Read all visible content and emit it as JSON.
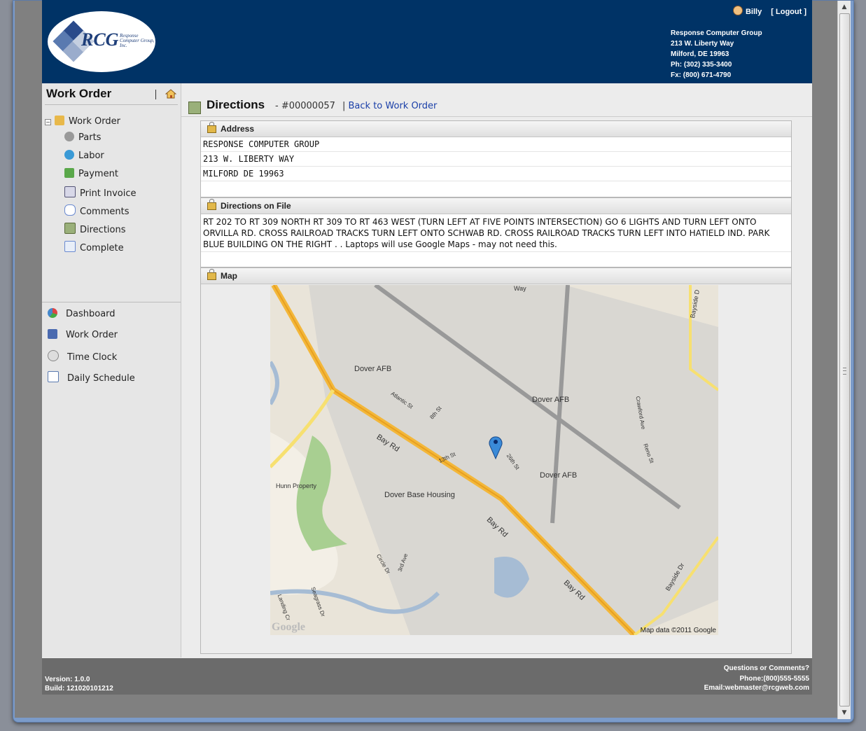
{
  "header": {
    "logo_text": "RCG",
    "logo_sub": "Response Computer Group, Inc.",
    "user": "Billy",
    "logout": "Logout",
    "company": [
      "Response Computer Group",
      "213 W. Liberty Way",
      "Milford, DE 19963",
      "Ph: (302) 335-3400",
      "Fx: (800) 671-4790"
    ]
  },
  "sidebar": {
    "title": "Work Order",
    "tree_root": "Work Order",
    "items": [
      "Parts",
      "Labor",
      "Payment",
      "Print Invoice",
      "Comments",
      "Directions",
      "Complete"
    ],
    "nav": [
      "Dashboard",
      "Work Order",
      "Time Clock",
      "Daily Schedule"
    ]
  },
  "content": {
    "title": "Directions",
    "order_number": "- #00000057",
    "back_link": "Back to Work Order",
    "address_title": "Address",
    "address": [
      "RESPONSE COMPUTER GROUP",
      "213 W. LIBERTY WAY",
      "MILFORD  DE  19963"
    ],
    "directions_title": "Directions on File",
    "directions_text": "RT 202 TO RT 309 NORTH RT 309 TO RT 463 WEST (TURN LEFT AT FIVE POINTS INTERSECTION) GO 6 LIGHTS AND TURN LEFT ONTO ORVILLA RD. CROSS RAILROAD TRACKS TURN LEFT ONTO SCHWAB RD. CROSS RAILROAD TRACKS TURN LEFT INTO HATIELD IND. PARK BLUE BUILDING ON THE RIGHT . . Laptops will use Google Maps - may not need this.",
    "map_title": "Map",
    "map_credit": "Map data ©2011 Google",
    "map_google": "Google",
    "map_labels": [
      "Dover AFB",
      "Dover AFB",
      "Dover AFB",
      "Dover Base Housing",
      "Hunn Property",
      "Bay Rd",
      "Bay Rd",
      "Bay Rd",
      "Atlantic St",
      "13th St",
      "8th St",
      "Crawford Ave",
      "Reno St",
      "Bayside Dr",
      "Bayside D",
      "Circle Dr",
      "3rd Ave",
      "26th St",
      "Landing Cr",
      "Seagrass Dr",
      "Way"
    ]
  },
  "footer": {
    "version": "Version: 1.0.0",
    "build": "Build: 121020101212",
    "questions": "Questions or Comments?",
    "phone": "Phone:(800)555-5555",
    "email": "Email:webmaster@rcgweb.com"
  }
}
